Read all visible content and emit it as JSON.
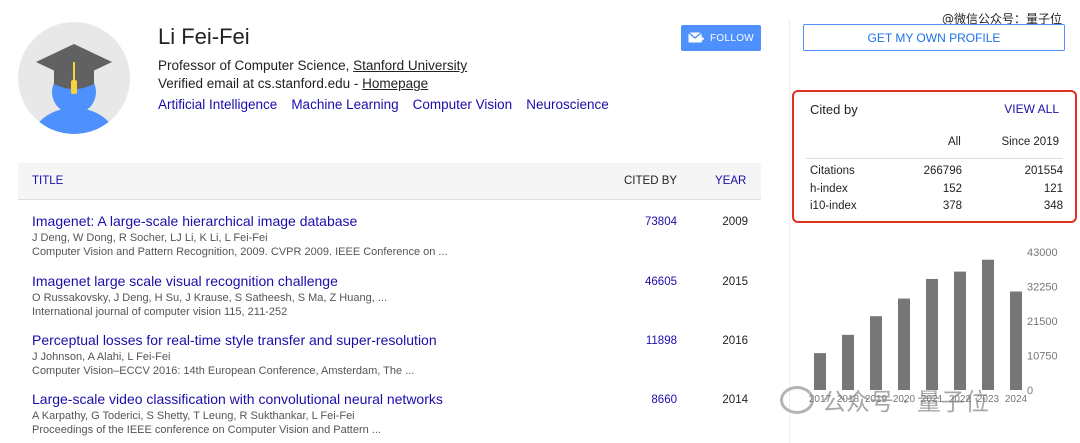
{
  "watermark": {
    "top": "@微信公众号：量子位",
    "bottom": "公众号 · 量子位"
  },
  "profile": {
    "name": "Li Fei-Fei",
    "affiliation_prefix": "Professor of Computer Science, ",
    "affiliation_link": "Stanford University",
    "verified": "Verified email at cs.stanford.edu - ",
    "homepage": "Homepage",
    "interests": [
      "Artificial Intelligence",
      "Machine Learning",
      "Computer Vision",
      "Neuroscience"
    ],
    "follow_label": "FOLLOW"
  },
  "table": {
    "headers": {
      "title": "TITLE",
      "cited_by": "CITED BY",
      "year": "YEAR"
    },
    "rows": [
      {
        "title": "Imagenet: A large-scale hierarchical image database",
        "authors": "J Deng, W Dong, R Socher, LJ Li, K Li, L Fei-Fei",
        "venue": "Computer Vision and Pattern Recognition, 2009. CVPR 2009. IEEE Conference on ...",
        "cited": "73804",
        "year": "2009"
      },
      {
        "title": "Imagenet large scale visual recognition challenge",
        "authors": "O Russakovsky, J Deng, H Su, J Krause, S Satheesh, S Ma, Z Huang, ...",
        "venue": "International journal of computer vision 115, 211-252",
        "cited": "46605",
        "year": "2015"
      },
      {
        "title": "Perceptual losses for real-time style transfer and super-resolution",
        "authors": "J Johnson, A Alahi, L Fei-Fei",
        "venue": "Computer Vision–ECCV 2016: 14th European Conference, Amsterdam, The ...",
        "cited": "11898",
        "year": "2016"
      },
      {
        "title": "Large-scale video classification with convolutional neural networks",
        "authors": "A Karpathy, G Toderici, S Shetty, T Leung, R Sukthankar, L Fei-Fei",
        "venue": "Proceedings of the IEEE conference on Computer Vision and Pattern ...",
        "cited": "8660",
        "year": "2014"
      }
    ]
  },
  "sidebar": {
    "profile_button": "GET MY OWN PROFILE",
    "cited_by": {
      "title": "Cited by",
      "view_all": "VIEW ALL",
      "col_all": "All",
      "col_since": "Since 2019",
      "rows": [
        {
          "label": "Citations",
          "all": "266796",
          "since": "201554"
        },
        {
          "label": "h-index",
          "all": "152",
          "since": "121"
        },
        {
          "label": "i10-index",
          "all": "378",
          "since": "348"
        }
      ]
    }
  },
  "chart_data": {
    "type": "bar",
    "categories": [
      "2017",
      "2018",
      "2019",
      "2020",
      "2021",
      "2022",
      "2023",
      "2024"
    ],
    "values": [
      11500,
      17200,
      23000,
      28500,
      34600,
      36900,
      40600,
      30700
    ],
    "yticks": [
      "43000",
      "32250",
      "21500",
      "10750",
      "0"
    ],
    "ylim": [
      0,
      43000
    ],
    "bar_color": "#777777"
  }
}
